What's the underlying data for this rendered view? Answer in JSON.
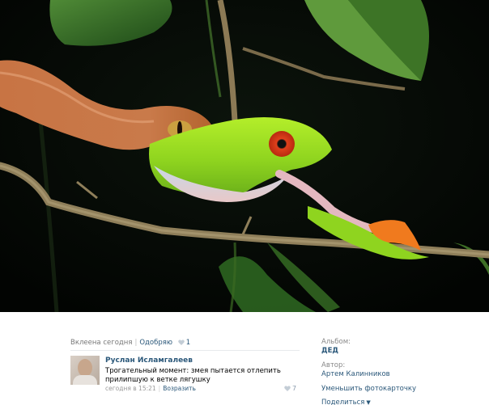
{
  "photo": {
    "description_icon": "photo-image"
  },
  "meta": {
    "uploaded": "Вклеена сегодня",
    "approve": "Одобряю",
    "likes": "1"
  },
  "comment": {
    "author": "Руслан Исламгалеев",
    "text": "Трогательный момент: змея пытается отлепить прилипшую к ветке лягушку",
    "time": "сегодня в 15:21",
    "reply": "Возразить",
    "likes": "7"
  },
  "sidebar": {
    "album_label": "Альбом:",
    "album_value": "ДЕД",
    "author_label": "Автор:",
    "author_value": "Артем Калинников",
    "reduce": "Уменьшить фотокарточку",
    "share": "Поделиться"
  },
  "colors": {
    "link": "#2b587a",
    "photo_background": "#050805"
  }
}
